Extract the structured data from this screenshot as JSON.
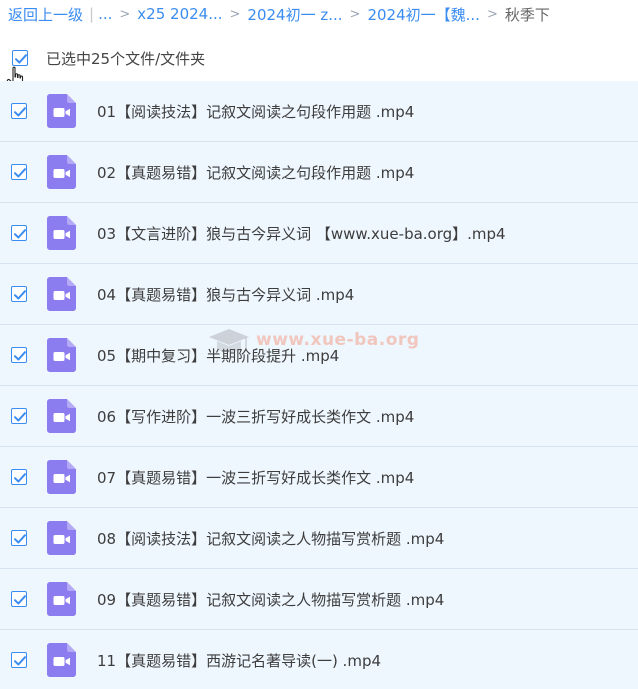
{
  "breadcrumb": {
    "back_label": "返回上一级",
    "separator": "|",
    "items": [
      "...",
      "x25 2024...",
      "2024初一 z...",
      "2024初一【魏...",
      "秋季下"
    ],
    "arrow": ">"
  },
  "selection": {
    "label": "已选中25个文件/文件夹",
    "checked": true
  },
  "files": [
    {
      "name": "01【阅读技法】记叙文阅读之句段作用题 .mp4",
      "checked": true,
      "icon": "video-file-icon"
    },
    {
      "name": "02【真题易错】记叙文阅读之句段作用题 .mp4",
      "checked": true,
      "icon": "video-file-icon"
    },
    {
      "name": "03【文言进阶】狼与古今异义词 【www.xue-ba.org】.mp4",
      "checked": true,
      "icon": "video-file-icon"
    },
    {
      "name": "04【真题易错】狼与古今异义词 .mp4",
      "checked": true,
      "icon": "video-file-icon"
    },
    {
      "name": "05【期中复习】半期阶段提升 .mp4",
      "checked": true,
      "icon": "video-file-icon"
    },
    {
      "name": "06【写作进阶】一波三折写好成长类作文 .mp4",
      "checked": true,
      "icon": "video-file-icon"
    },
    {
      "name": "07【真题易错】一波三折写好成长类作文 .mp4",
      "checked": true,
      "icon": "video-file-icon"
    },
    {
      "name": "08【阅读技法】记叙文阅读之人物描写赏析题 .mp4",
      "checked": true,
      "icon": "video-file-icon"
    },
    {
      "name": "09【真题易错】记叙文阅读之人物描写赏析题 .mp4",
      "checked": true,
      "icon": "video-file-icon"
    },
    {
      "name": "11【真题易错】西游记名著导读(一) .mp4",
      "checked": true,
      "icon": "video-file-icon"
    }
  ],
  "watermark": {
    "text": "www.xue-ba.org"
  },
  "colors": {
    "accent": "#3b8cf0",
    "row_bg": "#eef6fe",
    "video_icon": "#8b7cf0"
  }
}
